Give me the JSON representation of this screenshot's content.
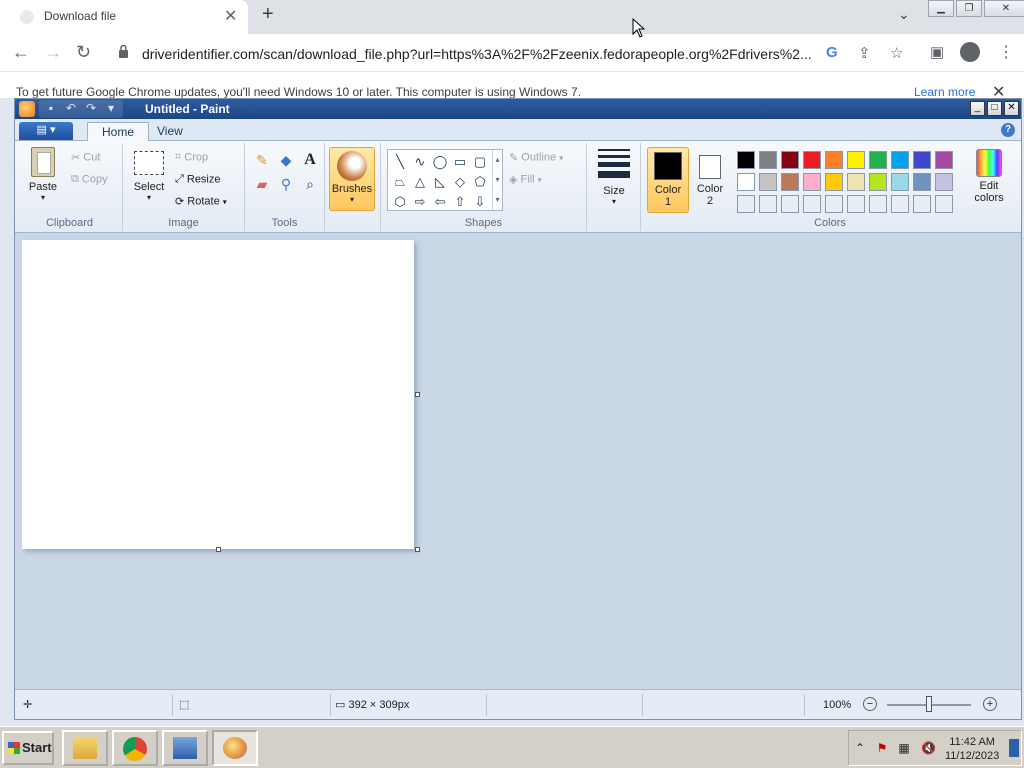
{
  "browser": {
    "tab_title": "Download file",
    "url": "driveridentifier.com/scan/download_file.php?url=https%3A%2F%2Fzeenix.fedorapeople.org%2Fdrivers%2...",
    "infobar_text": "To get future Google Chrome updates, you'll need Windows 10 or later. This computer is using Windows 7.",
    "infobar_link": "Learn more"
  },
  "paint": {
    "title": "Untitled - Paint",
    "tabs": [
      "Home",
      "View"
    ],
    "clipboard": {
      "paste": "Paste",
      "cut": "Cut",
      "copy": "Copy",
      "label": "Clipboard"
    },
    "image": {
      "select": "Select",
      "crop": "Crop",
      "resize": "Resize",
      "rotate": "Rotate",
      "label": "Image"
    },
    "tools": {
      "label": "Tools"
    },
    "brushes": {
      "label": "Brushes"
    },
    "shapes": {
      "outline": "Outline",
      "fill": "Fill",
      "label": "Shapes"
    },
    "size": {
      "label": "Size"
    },
    "colors": {
      "color1": "Color\n1",
      "color2": "Color\n2",
      "color1_line1": "Color",
      "color1_line2": "1",
      "color2_line1": "Color",
      "color2_line2": "2",
      "edit": "Edit colors",
      "label": "Colors",
      "color1_value": "#000000",
      "color2_value": "#ffffff",
      "palette_row1": [
        "#000000",
        "#7f7f7f",
        "#880015",
        "#ed1c24",
        "#ff7f27",
        "#fff200",
        "#22b14c",
        "#00a2e8",
        "#3f48cc",
        "#a349a4"
      ],
      "palette_row2": [
        "#ffffff",
        "#c3c3c3",
        "#b97a57",
        "#ffaec9",
        "#ffc90e",
        "#efe4b0",
        "#b5e61d",
        "#99d9ea",
        "#7092be",
        "#c8bfe7"
      ],
      "palette_row3": [
        "#e8eef6",
        "#e8eef6",
        "#e8eef6",
        "#e8eef6",
        "#e8eef6",
        "#e8eef6",
        "#e8eef6",
        "#e8eef6",
        "#e8eef6",
        "#e8eef6"
      ]
    },
    "status": {
      "canvas_size": "392 × 309px",
      "zoom": "100%"
    }
  },
  "taskbar": {
    "start": "Start",
    "time": "11:42 AM",
    "date": "11/12/2023"
  }
}
